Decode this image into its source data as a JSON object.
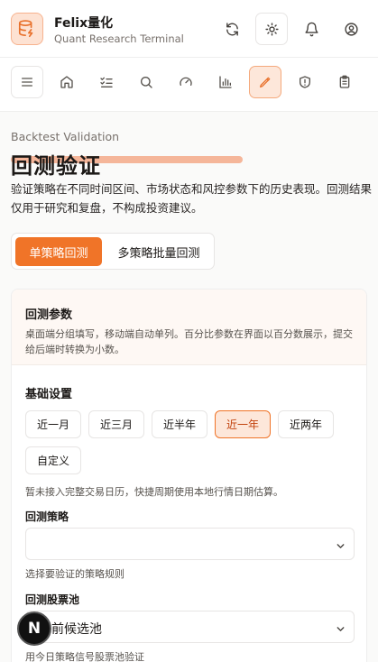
{
  "header": {
    "logo_icon": "database-bolt-icon",
    "brand_name": "Felix量化",
    "brand_sub": "Quant Research Terminal",
    "actions": [
      "refresh-icon",
      "sun-icon",
      "bell-icon",
      "user-circle-icon"
    ]
  },
  "nav": {
    "items": [
      "menu-icon",
      "home-icon",
      "checklist-icon",
      "search-icon",
      "gauge-icon",
      "bar-chart-icon",
      "pencil-ruler-icon",
      "shield-alert-icon",
      "clipboard-icon"
    ],
    "active_item": "pencil-ruler-icon"
  },
  "page": {
    "eyebrow": "Backtest Validation",
    "title": "回测验证",
    "description": "验证策略在不同时间区间、市场状态和风控参数下的历史表现。回测结果仅用于研究和复盘，不构成投资建议。"
  },
  "mode_tabs": {
    "single": "单策略回测",
    "batch": "多策略批量回测",
    "active": "单策略回测"
  },
  "params": {
    "title": "回测参数",
    "description": "桌面端分组填写，移动端自动单列。百分比参数在界面以百分数展示，提交给后端时转换为小数。",
    "basic_section": "基础设置",
    "periods": [
      "近一月",
      "近三月",
      "近半年",
      "近一年",
      "近两年",
      "自定义"
    ],
    "selected_period": "近一年",
    "period_hint": "暂未接入完整交易日历，快捷周期使用本地行情日期估算。",
    "strategy_label": "回测策略",
    "strategy_value": "",
    "strategy_hint": "选择要验证的策略规则",
    "pool_label": "回测股票池",
    "pool_value": "当前候选池",
    "pool_hint": "用今日策略信号股票池验证"
  },
  "fab_label": "N",
  "colors": {
    "accent": "#f07428",
    "accent_soft": "#fde7da"
  }
}
